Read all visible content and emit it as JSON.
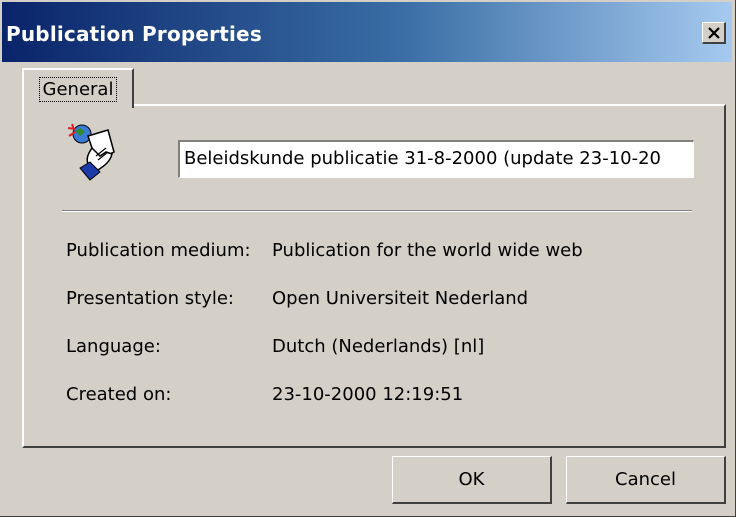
{
  "window": {
    "title": "Publication Properties"
  },
  "tabs": [
    {
      "label": "General"
    }
  ],
  "general": {
    "name_value": "Beleidskunde publicatie 31-8-2000 (update 23-10-20",
    "fields": [
      {
        "label": "Publication medium:",
        "value": "Publication for the world wide web"
      },
      {
        "label": "Presentation style:",
        "value": "Open Universiteit Nederland"
      },
      {
        "label": "Language:",
        "value": "Dutch (Nederlands)  [nl]"
      },
      {
        "label": "Created on:",
        "value": "23-10-2000 12:19:51"
      }
    ]
  },
  "buttons": {
    "ok_label": "OK",
    "cancel_label": "Cancel"
  },
  "icons": {
    "close": "close-icon",
    "publication": "publication-icon"
  },
  "colors": {
    "titlebar_start": "#0a246a",
    "titlebar_end": "#a6caf0",
    "dialog_face": "#d4d0c8"
  }
}
